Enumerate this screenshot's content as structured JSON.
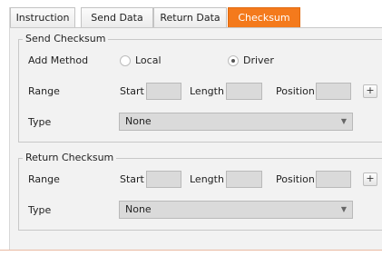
{
  "tabs": [
    {
      "label": "Instruction",
      "active": false
    },
    {
      "label": "Send Data",
      "active": false
    },
    {
      "label": "Return Data",
      "active": false
    },
    {
      "label": "Checksum",
      "active": true
    }
  ],
  "colors": {
    "active_tab": "#f47a1c",
    "panel_bg": "#f2f2f2",
    "field_bg": "#dadada"
  },
  "send_checksum": {
    "title": "Send Checksum",
    "add_method_label": "Add Method",
    "option_local": "Local",
    "option_driver": "Driver",
    "selected_method": "Driver",
    "range_label": "Range",
    "start_label": "Start",
    "start_value": "",
    "length_label": "Length",
    "length_value": "",
    "position_label": "Position",
    "position_value": "",
    "plus_label": "+",
    "type_label": "Type",
    "type_value": "None"
  },
  "return_checksum": {
    "title": "Return Checksum",
    "range_label": "Range",
    "start_label": "Start",
    "start_value": "",
    "length_label": "Length",
    "length_value": "",
    "position_label": "Position",
    "position_value": "",
    "plus_label": "+",
    "type_label": "Type",
    "type_value": "None"
  },
  "icons": {
    "dropdown": "chevron-down-icon",
    "add": "plus-icon"
  }
}
